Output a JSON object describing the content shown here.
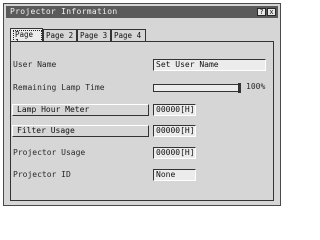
{
  "window": {
    "title": "Projector Information",
    "help_label": "?",
    "close_label": "x"
  },
  "tabs": [
    {
      "label": "Page 1",
      "active": true
    },
    {
      "label": "Page 2",
      "active": false
    },
    {
      "label": "Page 3",
      "active": false
    },
    {
      "label": "Page 4",
      "active": false
    }
  ],
  "rows": {
    "user_name": {
      "label": "User Name",
      "value": "Set User Name"
    },
    "lamp_time": {
      "label": "Remaining Lamp Time",
      "percent_text": "100%",
      "percent": 100
    },
    "lamp_hour": {
      "label": "Lamp Hour Meter",
      "value": "00000[H]"
    },
    "filter": {
      "label": "Filter Usage",
      "value": "00000[H]"
    },
    "projector_usage": {
      "label": "Projector Usage",
      "value": "00000[H]"
    },
    "projector_id": {
      "label": "Projector ID",
      "value": "None"
    }
  }
}
